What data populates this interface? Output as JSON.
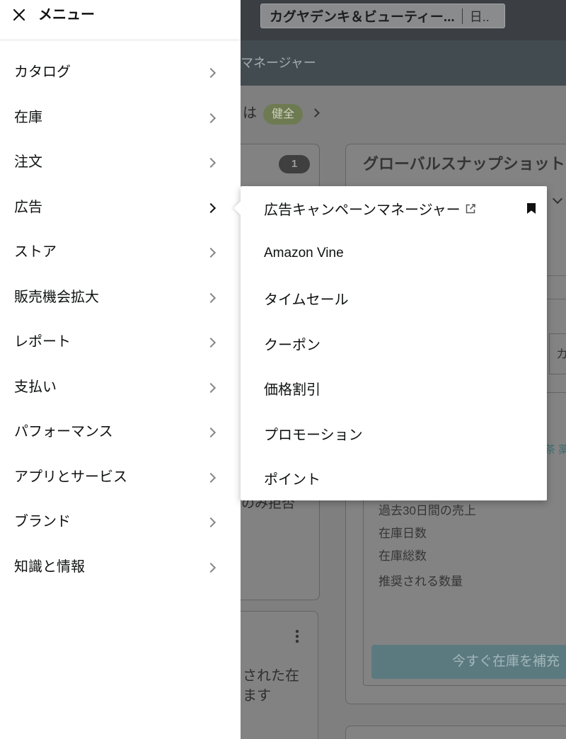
{
  "menu": {
    "title": "メニュー",
    "items": [
      {
        "label": "カタログ"
      },
      {
        "label": "在庫"
      },
      {
        "label": "注文"
      },
      {
        "label": "広告",
        "active": true
      },
      {
        "label": "ストア"
      },
      {
        "label": "販売機会拡大"
      },
      {
        "label": "レポート"
      },
      {
        "label": "支払い"
      },
      {
        "label": "パフォーマンス"
      },
      {
        "label": "アプリとサービス"
      },
      {
        "label": "ブランド"
      },
      {
        "label": "知識と情報"
      }
    ]
  },
  "submenu": {
    "items": [
      {
        "label": "広告キャンペーンマネージャー",
        "external_link": true,
        "bookmarked": true
      },
      {
        "label": "Amazon Vine"
      },
      {
        "label": "タイムセール"
      },
      {
        "label": "クーポン"
      },
      {
        "label": "価格割引"
      },
      {
        "label": "プロモーション"
      },
      {
        "label": "ポイント"
      }
    ]
  },
  "page": {
    "header": {
      "store_name": "カグヤデンキ＆ビューティー...",
      "marketplace": "日.."
    },
    "nav": {
      "title": "マネージャー"
    },
    "health": {
      "prefix": "は",
      "status": "健全"
    },
    "left_card": {
      "count": "1",
      "note": "のみ拒否"
    },
    "lower_left_card": {
      "line1": "された在",
      "line2": "ます"
    },
    "snapshot": {
      "title": "グローバルスナップショット",
      "tab_text": "カ",
      "link_text": "茶 薬",
      "metrics": [
        "過去30日間の売上",
        "在庫日数",
        "在庫総数",
        "推奨される数量"
      ],
      "replenish_button": "今すぐ在庫を補充"
    }
  },
  "icons": {
    "close": "close-icon",
    "chevron": "chevron-right-icon",
    "external": "external-link-icon",
    "bookmark": "bookmark-icon",
    "dropdown": "chevron-down-icon",
    "more": "kebab-menu-icon"
  },
  "colors": {
    "menu-bg": "#ffffff",
    "text": "#0f1111",
    "topbar": "#3b3f44",
    "navbar": "#424b50",
    "page-bg": "#7f7f7f",
    "health": "#6e7b52",
    "button": "#5b7a80",
    "link": "#3f6d70"
  }
}
